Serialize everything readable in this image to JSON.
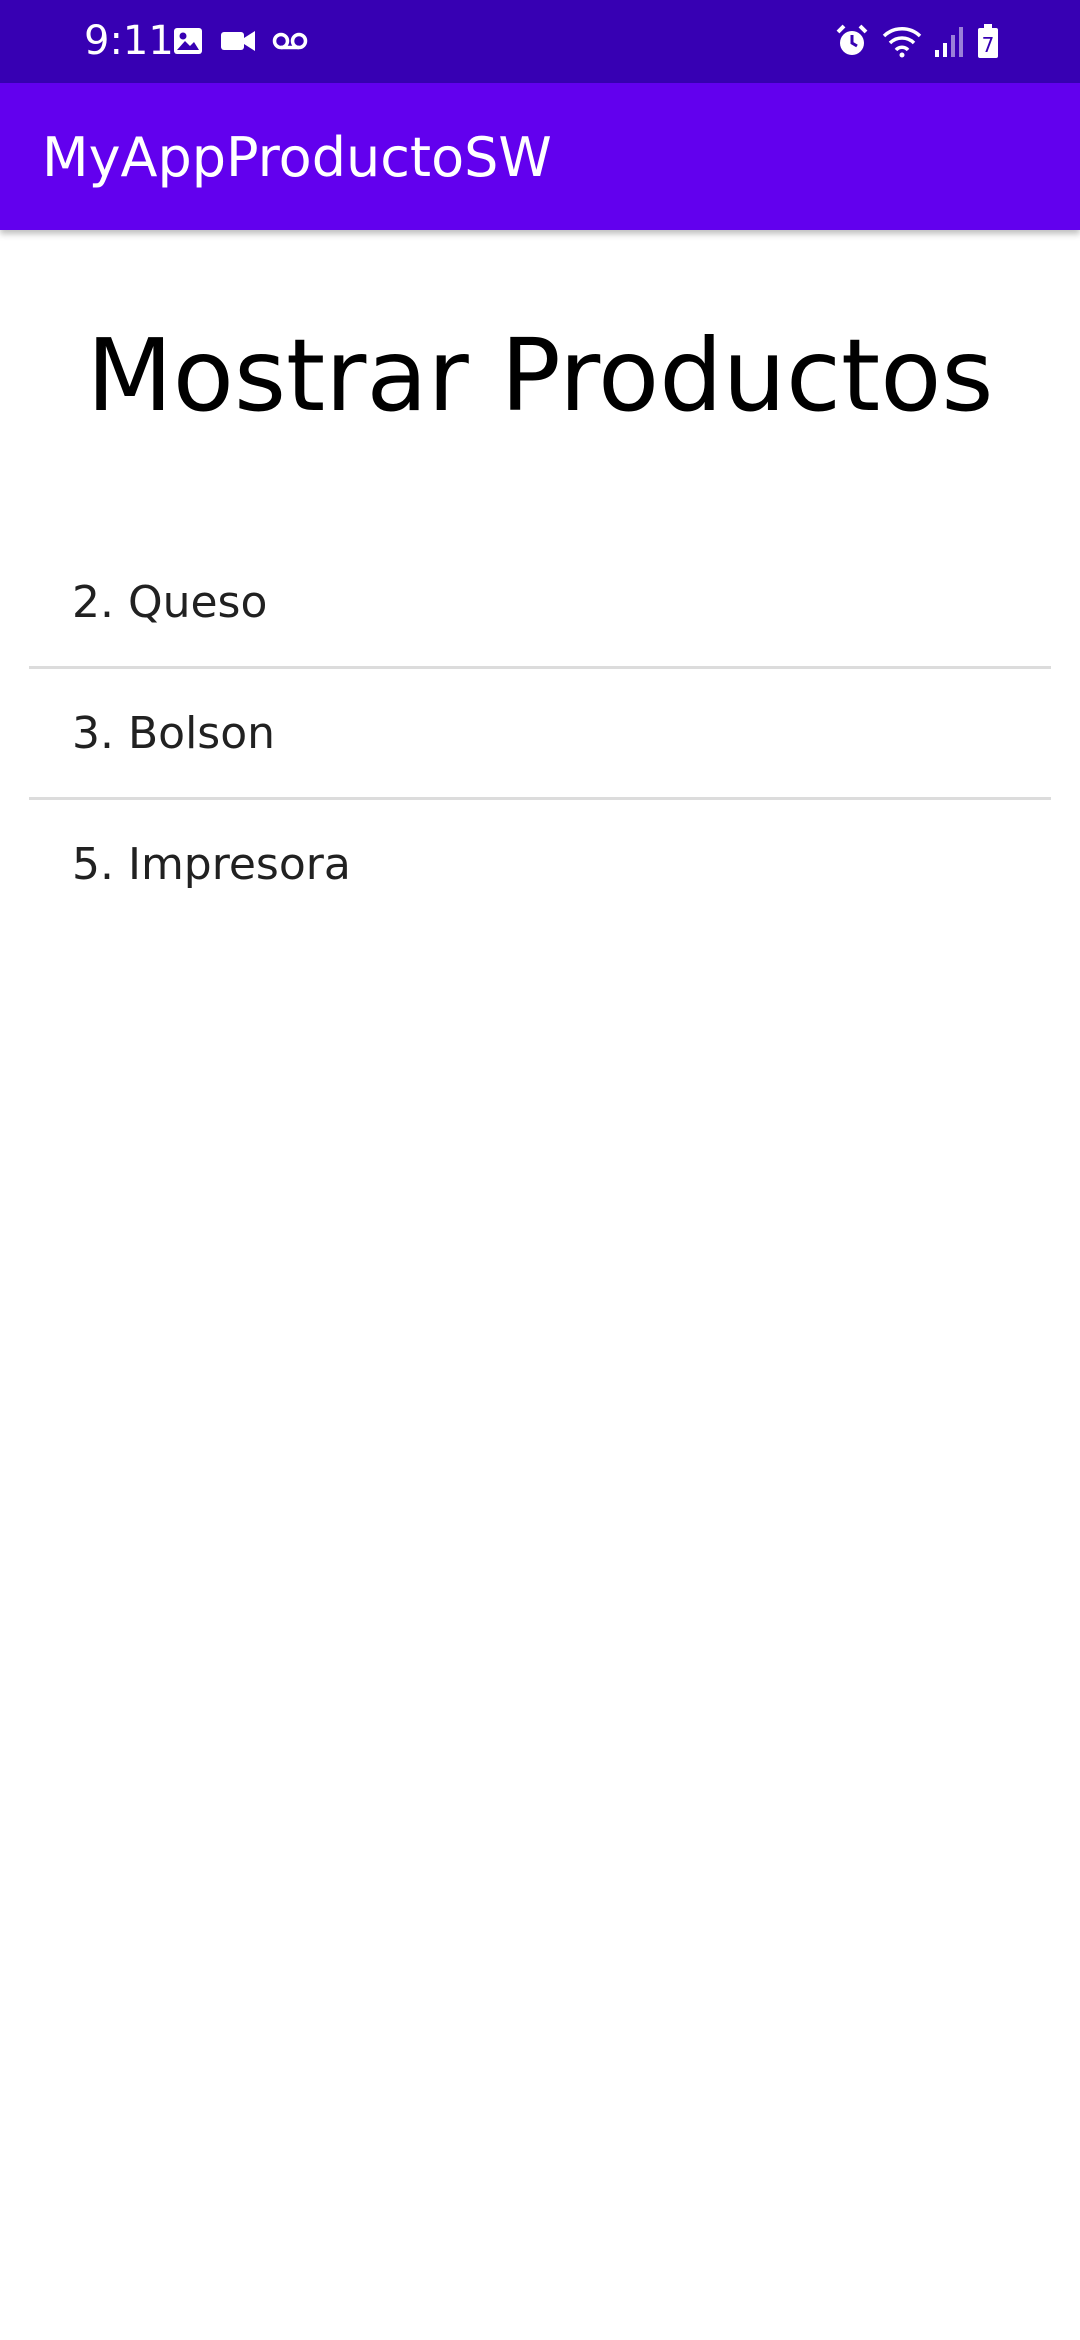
{
  "status_bar": {
    "time": "9:11",
    "icons_left": [
      "image-icon",
      "video-camera-icon",
      "voicemail-icon"
    ],
    "icons_right": [
      "alarm-icon",
      "wifi-icon",
      "signal-icon",
      "battery-icon"
    ],
    "battery_level": "7",
    "background_color": "#3700b3"
  },
  "app_bar": {
    "title": "MyAppProductoSW",
    "background_color": "#6200ee"
  },
  "main": {
    "title": "Mostrar Productos",
    "products": [
      {
        "label": "2. Queso"
      },
      {
        "label": "3. Bolson"
      },
      {
        "label": "5. Impresora"
      }
    ]
  }
}
